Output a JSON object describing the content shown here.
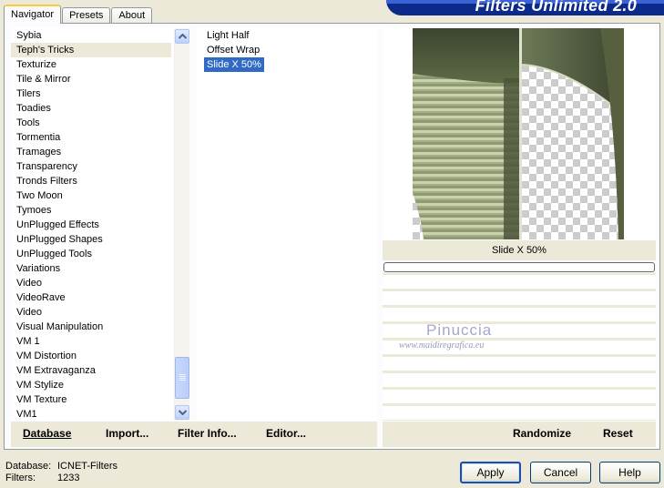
{
  "app": {
    "title": "Filters Unlimited 2.0"
  },
  "tabs": [
    {
      "label": "Navigator",
      "active": true
    },
    {
      "label": "Presets",
      "active": false
    },
    {
      "label": "About",
      "active": false
    }
  ],
  "categories": {
    "items": [
      "Sybia",
      "Teph's Tricks",
      "Texturize",
      "Tile & Mirror",
      "Tilers",
      "Toadies",
      "Tools",
      "Tormentia",
      "Tramages",
      "Transparency",
      "Tronds Filters",
      "Two Moon",
      "Tymoes",
      "UnPlugged Effects",
      "UnPlugged Shapes",
      "UnPlugged Tools",
      "Variations",
      "Video",
      "VideoRave",
      "Video",
      "Visual Manipulation",
      "VM 1",
      "VM Distortion",
      "VM Extravaganza",
      "VM Stylize",
      "VM Texture",
      "VM1"
    ],
    "selected": "Teph's Tricks"
  },
  "filters": {
    "items": [
      "Light Half",
      "Offset Wrap",
      "Slide X 50%"
    ],
    "selected": "Slide X 50%"
  },
  "preview": {
    "filter_name": "Slide X 50%",
    "progress": 0
  },
  "watermark": {
    "name": "Pinuccia",
    "url": "www.maidiregrafica.eu"
  },
  "left_actions": {
    "database": "Database",
    "import": "Import...",
    "filter_info": "Filter Info...",
    "editor": "Editor..."
  },
  "right_actions": {
    "randomize": "Randomize",
    "reset": "Reset"
  },
  "status": {
    "database_label": "Database:",
    "database_value": "ICNET-Filters",
    "filters_label": "Filters:",
    "filters_value": "1233"
  },
  "buttons": {
    "apply": "Apply",
    "cancel": "Cancel",
    "help": "Help"
  },
  "colors": {
    "selection": "#316ac5",
    "banner": "#0b2a8a",
    "dialog_bg": "#ece9d8"
  },
  "icons": {
    "scroll_up": "scroll-up-arrow-icon",
    "scroll_down": "scroll-down-arrow-icon"
  }
}
